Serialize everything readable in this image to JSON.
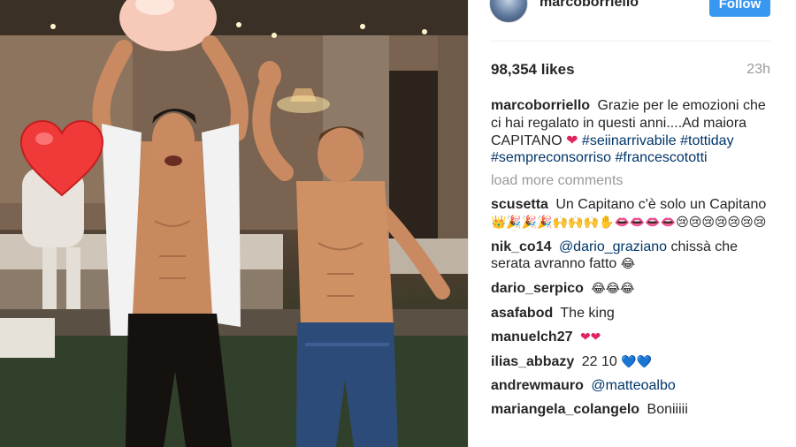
{
  "post": {
    "owner": "marcoborriello",
    "follow_label": "Follow",
    "likes": "98,354 likes",
    "timestamp": "23h",
    "caption_text": "Grazie per le emozioni che ci hai regalato in questi anni....Ad maiora CAPITANO",
    "caption_emoji": "❤",
    "hashtags": [
      "#seiinarrivabile",
      "#tottiday",
      "#sempreconsorriso",
      "#francescototti"
    ],
    "load_more": "load more comments"
  },
  "comments": [
    {
      "user": "scusetta",
      "text": "Un Capitano c'è solo un Capitano",
      "emoji": "👑🎉🎉🎉🙌🙌🙌✋👄👄👄👄😢😢😢😢😢😢😢"
    },
    {
      "user": "nik_co14",
      "mention": "@dario_graziano",
      "text": "chissà che serata avranno fatto",
      "emoji": "😂"
    },
    {
      "user": "dario_serpico",
      "text": "",
      "emoji": "😂😂😂"
    },
    {
      "user": "asafabod",
      "text": "The king",
      "emoji": ""
    },
    {
      "user": "manuelch27",
      "text": "",
      "emoji": "❤❤"
    },
    {
      "user": "ilias_abbazy",
      "text": "22 10",
      "emoji": "💙💙"
    },
    {
      "user": "andrewmauro",
      "mention": "@matteoalbo",
      "text": "",
      "emoji": ""
    },
    {
      "user": "mariangela_colangelo",
      "text": "Boniiiii",
      "emoji": ""
    }
  ],
  "colors": {
    "follow_bg": "#3897f0",
    "hashtag": "#003569",
    "muted": "#999999",
    "heart_sticker": "#f03a3a"
  },
  "icons": [
    "avatar",
    "heart-sticker"
  ]
}
